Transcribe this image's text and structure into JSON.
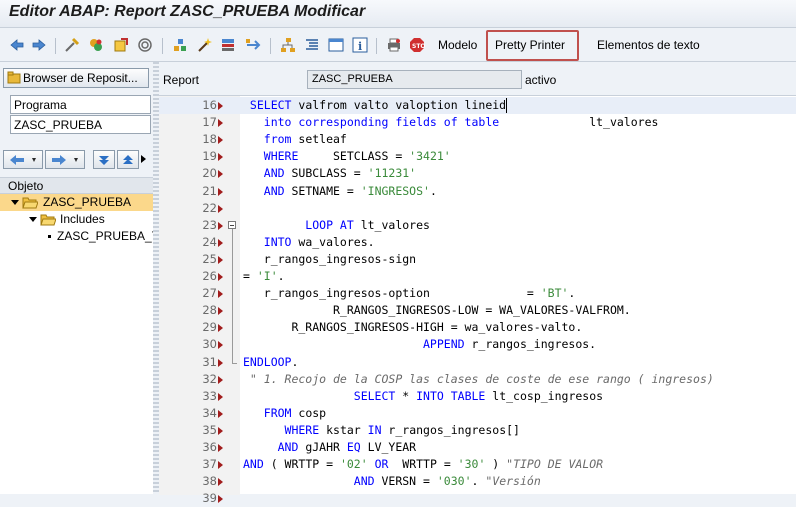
{
  "window": {
    "title": "Editor ABAP: Report ZASC_PRUEBA Modificar"
  },
  "toolbar": {
    "model_label": "Modelo",
    "pretty_printer_label": "Pretty Printer",
    "text_elements_label": "Elementos de texto"
  },
  "left_pane": {
    "browser_button_label": "Browser de Reposit...",
    "type_field_value": "Programa",
    "name_field_value": "ZASC_PRUEBA",
    "object_header": "Objeto",
    "tree": [
      {
        "label": "ZASC_PRUEBA",
        "selected": true
      },
      {
        "label": "Includes",
        "selected": false
      },
      {
        "label": "ZASC_PRUEBA_T",
        "selected": false
      }
    ]
  },
  "report_bar": {
    "label": "Report",
    "name": "ZASC_PRUEBA",
    "status": "activo"
  },
  "colors": {
    "keyword": "#0000ff",
    "string": "#3a8a3a",
    "comment": "#6a6a6a",
    "highlight_box": "#c0504d",
    "tree_selection": "#fbd88b"
  },
  "code_lines": [
    {
      "num": "16",
      "segments": [
        {
          "t": " SELECT ",
          "c": "kw"
        },
        {
          "t": "valfrom valto valoption lineid",
          "c": ""
        }
      ]
    },
    {
      "num": "17",
      "segments": [
        {
          "t": "   into corresponding fields of table ",
          "c": "kw"
        },
        {
          "t": "            lt_valores",
          "c": ""
        }
      ]
    },
    {
      "num": "18",
      "segments": [
        {
          "t": "   from ",
          "c": "kw"
        },
        {
          "t": "setleaf",
          "c": ""
        }
      ]
    },
    {
      "num": "19",
      "segments": [
        {
          "t": "   WHERE ",
          "c": "kw"
        },
        {
          "t": "    SETCLASS = ",
          "c": ""
        },
        {
          "t": "'3421'",
          "c": "str"
        }
      ]
    },
    {
      "num": "20",
      "segments": [
        {
          "t": "   AND ",
          "c": "kw"
        },
        {
          "t": "SUBCLASS = ",
          "c": ""
        },
        {
          "t": "'11231'",
          "c": "str"
        }
      ]
    },
    {
      "num": "21",
      "segments": [
        {
          "t": "   AND ",
          "c": "kw"
        },
        {
          "t": "SETNAME = ",
          "c": ""
        },
        {
          "t": "'INGRESOS'",
          "c": "str"
        },
        {
          "t": ".",
          "c": ""
        }
      ]
    },
    {
      "num": "22",
      "segments": []
    },
    {
      "num": "23",
      "segments": [
        {
          "t": "         LOOP AT ",
          "c": "kw"
        },
        {
          "t": "lt_valores",
          "c": ""
        }
      ]
    },
    {
      "num": "24",
      "segments": [
        {
          "t": "   INTO ",
          "c": "kw"
        },
        {
          "t": "wa_valores.",
          "c": ""
        }
      ]
    },
    {
      "num": "25",
      "segments": [
        {
          "t": "   r_rangos_ingresos-sign",
          "c": ""
        }
      ]
    },
    {
      "num": "26",
      "segments": [
        {
          "t": "= ",
          "c": ""
        },
        {
          "t": "'I'",
          "c": "str"
        },
        {
          "t": ".",
          "c": ""
        }
      ]
    },
    {
      "num": "27",
      "segments": [
        {
          "t": "   r_rangos_ingresos-option              = ",
          "c": ""
        },
        {
          "t": "'BT'",
          "c": "str"
        },
        {
          "t": ".",
          "c": ""
        }
      ]
    },
    {
      "num": "28",
      "segments": [
        {
          "t": "             R_RANGOS_INGRESOS-LOW = WA_VALORES-VALFROM.",
          "c": ""
        }
      ]
    },
    {
      "num": "29",
      "segments": [
        {
          "t": "       R_RANGOS_INGRESOS-HIGH = wa_valores-valto.",
          "c": ""
        }
      ]
    },
    {
      "num": "30",
      "segments": [
        {
          "t": "                          APPEND ",
          "c": "kw"
        },
        {
          "t": "r_rangos_ingresos.",
          "c": ""
        }
      ]
    },
    {
      "num": "31",
      "segments": [
        {
          "t": "ENDLOOP",
          "c": "kw"
        },
        {
          "t": ".",
          "c": ""
        }
      ]
    },
    {
      "num": "32",
      "segments": [
        {
          "t": " \" 1. Recojo de la COSP las clases de coste de ese rango ( ingresos)",
          "c": "cm"
        }
      ]
    },
    {
      "num": "33",
      "segments": [
        {
          "t": "                SELECT ",
          "c": "kw"
        },
        {
          "t": "* ",
          "c": ""
        },
        {
          "t": "INTO TABLE ",
          "c": "kw"
        },
        {
          "t": "lt_cosp_ingresos",
          "c": ""
        }
      ]
    },
    {
      "num": "34",
      "segments": [
        {
          "t": "   FROM ",
          "c": "kw"
        },
        {
          "t": "cosp",
          "c": ""
        }
      ]
    },
    {
      "num": "35",
      "segments": [
        {
          "t": "      WHERE ",
          "c": "kw"
        },
        {
          "t": "kstar ",
          "c": ""
        },
        {
          "t": "IN ",
          "c": "kw"
        },
        {
          "t": "r_rangos_ingresos[]",
          "c": ""
        }
      ]
    },
    {
      "num": "36",
      "segments": [
        {
          "t": "     AND ",
          "c": "kw"
        },
        {
          "t": "gJAHR ",
          "c": ""
        },
        {
          "t": "EQ ",
          "c": "kw"
        },
        {
          "t": "LV_YEAR",
          "c": ""
        }
      ]
    },
    {
      "num": "37",
      "segments": [
        {
          "t": "AND ",
          "c": "kw"
        },
        {
          "t": "( WRTTP = ",
          "c": ""
        },
        {
          "t": "'02' ",
          "c": "str"
        },
        {
          "t": "OR ",
          "c": "kw"
        },
        {
          "t": " WRTTP = ",
          "c": ""
        },
        {
          "t": "'30'",
          "c": "str"
        },
        {
          "t": " ) ",
          "c": ""
        },
        {
          "t": "\"TIPO DE VALOR",
          "c": "cm"
        }
      ]
    },
    {
      "num": "38",
      "segments": [
        {
          "t": "                AND ",
          "c": "kw"
        },
        {
          "t": "VERSN = ",
          "c": ""
        },
        {
          "t": "'030'",
          "c": "str"
        },
        {
          "t": ". ",
          "c": ""
        },
        {
          "t": "\"Versión",
          "c": "cm"
        }
      ]
    },
    {
      "num": "39",
      "segments": []
    }
  ]
}
